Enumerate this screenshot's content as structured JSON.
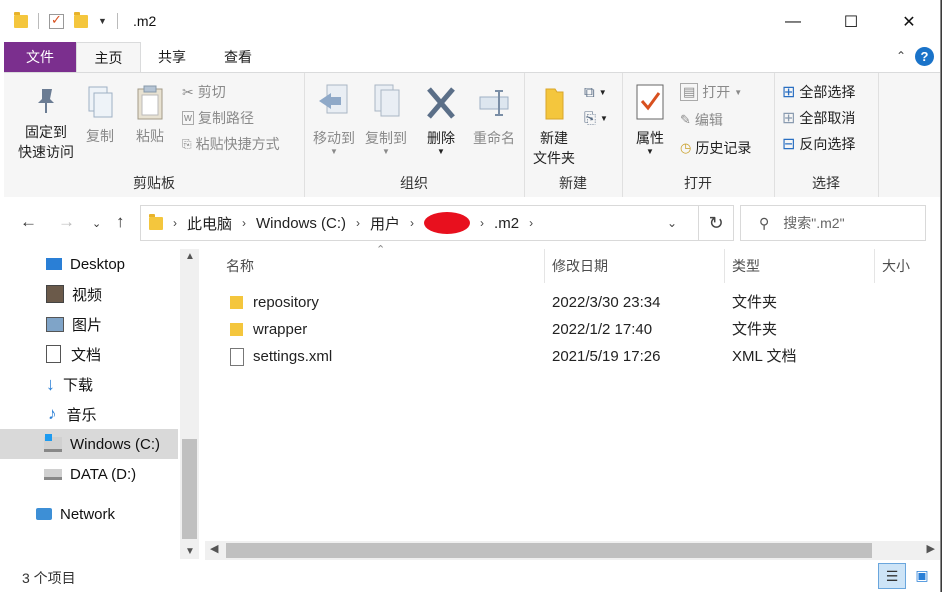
{
  "window": {
    "title": ".m2",
    "controls": {
      "minimize": "—",
      "maximize": "☐",
      "close": "✕"
    }
  },
  "tabs": [
    {
      "label": "文件"
    },
    {
      "label": "主页"
    },
    {
      "label": "共享"
    },
    {
      "label": "查看"
    }
  ],
  "ribbon": {
    "clipboard": {
      "label": "剪贴板",
      "pin": "固定到\n快速访问",
      "copy": "复制",
      "paste": "粘贴",
      "cut": "剪切",
      "copy_path": "复制路径",
      "paste_shortcut": "粘贴快捷方式"
    },
    "organize": {
      "label": "组织",
      "move_to": "移动到",
      "copy_to": "复制到",
      "delete": "删除",
      "rename": "重命名"
    },
    "new": {
      "label": "新建",
      "new_folder": "新建\n文件夹"
    },
    "open": {
      "label": "打开",
      "properties": "属性",
      "open": "打开",
      "edit": "编辑",
      "history": "历史记录"
    },
    "select": {
      "label": "选择",
      "select_all": "全部选择",
      "select_none": "全部取消",
      "invert": "反向选择"
    }
  },
  "address": {
    "crumbs": [
      "此电脑",
      "Windows (C:)",
      "用户",
      ".m2"
    ],
    "search_placeholder": "搜索\".m2\""
  },
  "nav": {
    "items": [
      {
        "label": "Desktop",
        "icon": "desktop-icon"
      },
      {
        "label": "视频",
        "icon": "video-icon"
      },
      {
        "label": "图片",
        "icon": "pictures-icon"
      },
      {
        "label": "文档",
        "icon": "documents-icon"
      },
      {
        "label": "下载",
        "icon": "download-icon"
      },
      {
        "label": "音乐",
        "icon": "music-icon"
      },
      {
        "label": "Windows (C:)",
        "icon": "drive-c-icon",
        "selected": true
      },
      {
        "label": "DATA (D:)",
        "icon": "drive-d-icon"
      },
      {
        "label": "Network",
        "icon": "network-icon"
      }
    ]
  },
  "columns": {
    "name": "名称",
    "date": "修改日期",
    "type": "类型",
    "size": "大小"
  },
  "files": [
    {
      "name": "repository",
      "date": "2022/3/30 23:34",
      "type": "文件夹",
      "icon": "folder-icon"
    },
    {
      "name": "wrapper",
      "date": "2022/1/2 17:40",
      "type": "文件夹",
      "icon": "folder-icon"
    },
    {
      "name": "settings.xml",
      "date": "2021/5/19 17:26",
      "type": "XML 文档",
      "icon": "xml-file-icon"
    }
  ],
  "status": {
    "count": "3 个项目"
  },
  "colors": {
    "file_tab": "#7b2f8e",
    "selection": "#d9d9d9",
    "folder": "#f4c63d",
    "accent": "#1a73c9"
  }
}
